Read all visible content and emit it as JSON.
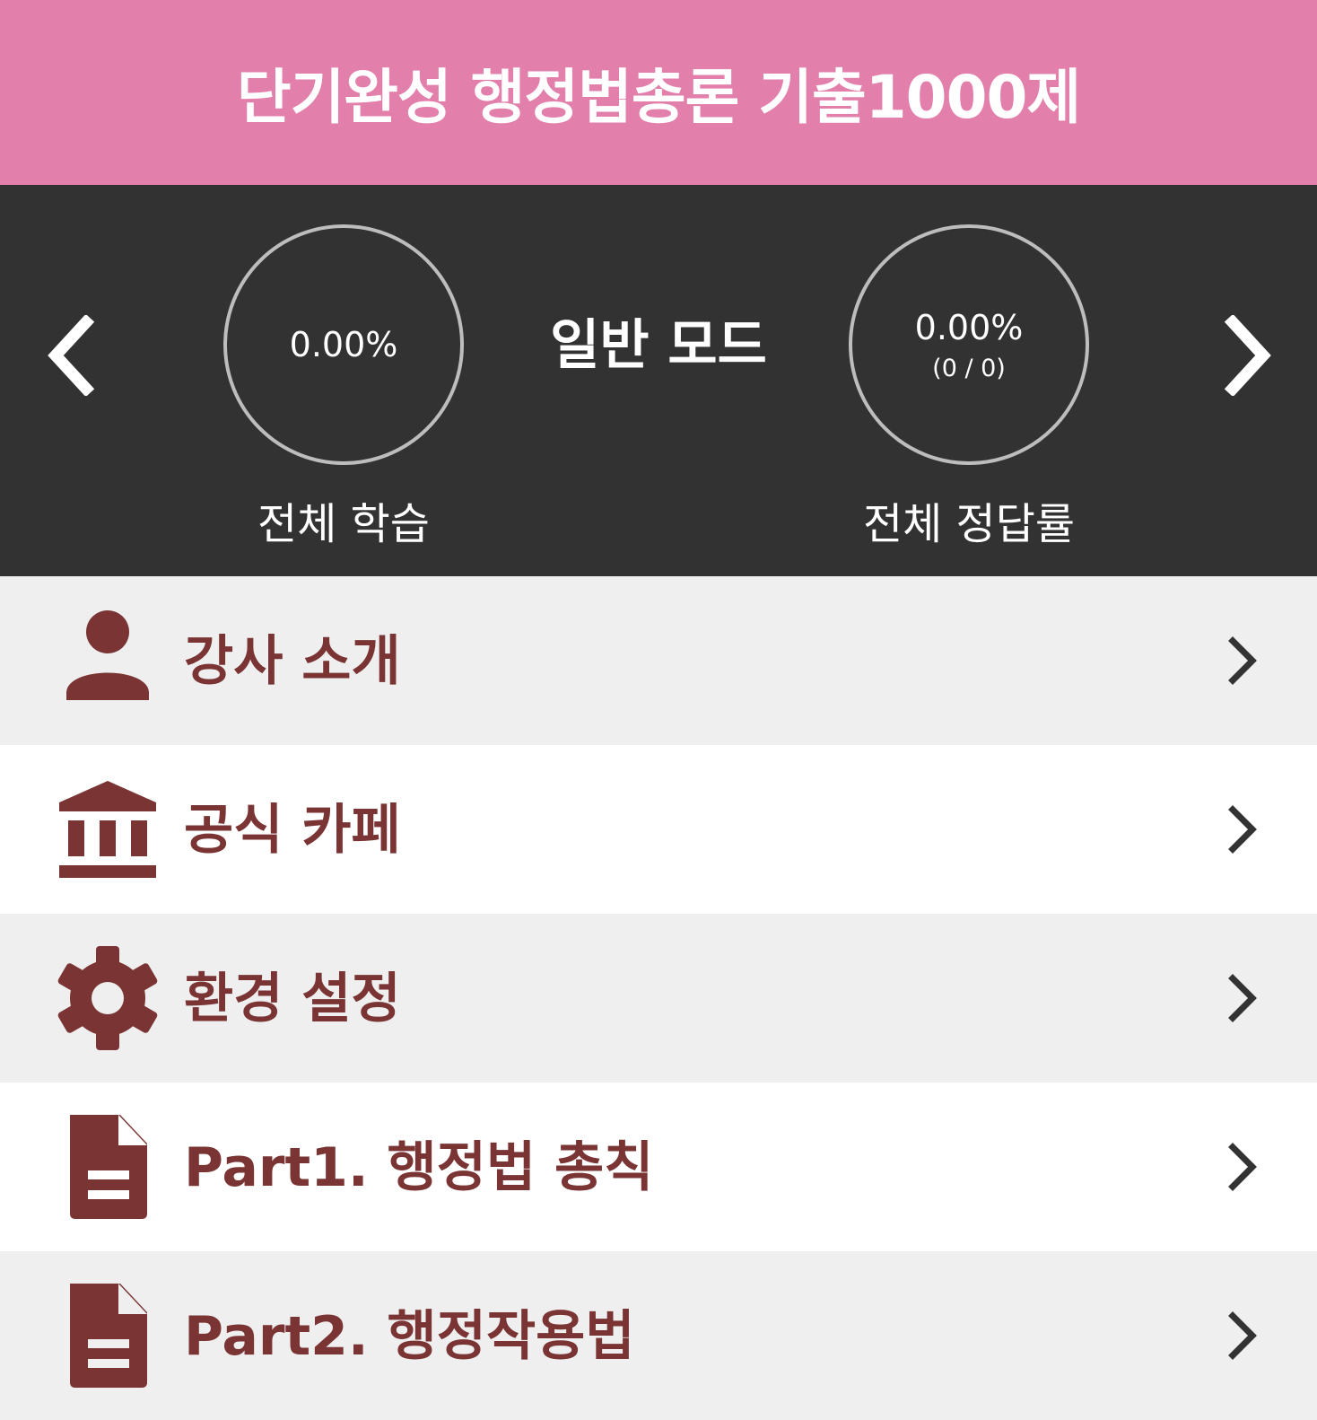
{
  "colors": {
    "header_bg": "#e37fab",
    "stats_bg": "#323232",
    "menu_text": "#7a3434",
    "row_alt_bg": "#efefef",
    "row_bg": "#ffffff",
    "chevron": "#333333"
  },
  "header": {
    "title": "단기완성 행정법총론 기출1000제"
  },
  "stats": {
    "mode": "일반 모드",
    "study": {
      "value": "0.00%",
      "label": "전체 학습"
    },
    "accuracy": {
      "value": "0.00%",
      "count": "(0 / 0)",
      "label": "전체 정답률"
    },
    "prev_icon": "chevron-left-icon",
    "next_icon": "chevron-right-icon"
  },
  "menu": {
    "items": [
      {
        "label": "강사 소개",
        "icon": "person-icon"
      },
      {
        "label": "공식 카페",
        "icon": "bank-icon"
      },
      {
        "label": "환경 설정",
        "icon": "gear-icon"
      },
      {
        "label": "Part1. 행정법 총칙",
        "icon": "document-icon"
      },
      {
        "label": "Part2. 행정작용법",
        "icon": "document-icon"
      }
    ]
  }
}
